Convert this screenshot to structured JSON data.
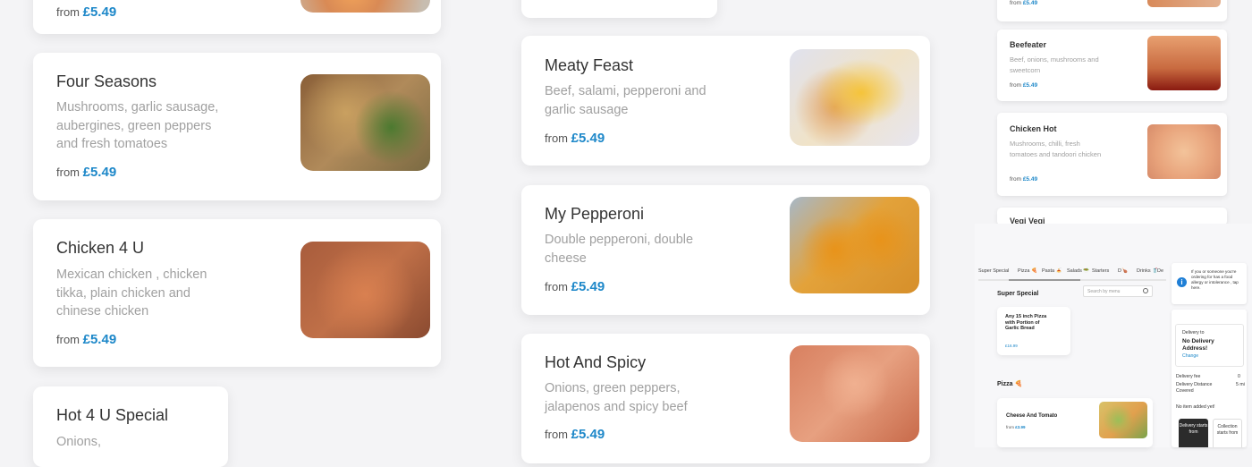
{
  "column1": {
    "top_card": {
      "price_prefix": "from",
      "price": "£5.49"
    },
    "cards": [
      {
        "name": "Four Seasons",
        "desc": "Mushrooms, garlic sausage, aubergines, green peppers and fresh tomatoes",
        "price_prefix": "from",
        "price": "£5.49"
      },
      {
        "name": "Chicken 4 U",
        "desc": "Mexican chicken , chicken tikka, plain chicken and chinese chicken",
        "price_prefix": "from",
        "price": "£5.49"
      },
      {
        "name": "Hot 4 U Special",
        "desc": "Onions,",
        "price_prefix": "",
        "price": ""
      }
    ]
  },
  "column2": {
    "cards": [
      {
        "name": "Meaty Feast",
        "desc": "Beef, salami, pepperoni and garlic sausage",
        "price_prefix": "from",
        "price": "£5.49"
      },
      {
        "name": "My Pepperoni",
        "desc": "Double pepperoni, double cheese",
        "price_prefix": "from",
        "price": "£5.49"
      },
      {
        "name": "Hot And Spicy",
        "desc": "Onions, green peppers, jalapenos and spicy beef",
        "price_prefix": "from",
        "price": "£5.49"
      }
    ]
  },
  "column3": {
    "top_card": {
      "price_prefix": "from",
      "price": "£5.49"
    },
    "cards": [
      {
        "name": "Beefeater",
        "desc": "Beef, onions, mushrooms and sweetcorn",
        "price_prefix": "from",
        "price": "£5.49"
      },
      {
        "name": "Chicken Hot",
        "desc": "Mushrooms, chilli, fresh tomatoes and tandoori chicken",
        "price_prefix": "from",
        "price": "£5.49"
      },
      {
        "name": "Vegi Vegi"
      }
    ],
    "mini": {
      "nav": [
        "Super Special",
        "Pizza 🍕",
        "Pasta 🍝",
        "Salads 🥗",
        "Starters",
        "D🍗",
        "Drinks 🥤",
        "De"
      ],
      "search_placeholder": "Search by menu",
      "section_super": "Super Special",
      "super_item": {
        "name": "Any 15 inch Pizza with Portion of Garlic Bread",
        "price": "£16.99"
      },
      "section_pizza": "Pizza 🍕",
      "pizza_item": {
        "name": "Cheese And Tomato",
        "price_prefix": "from",
        "price": "£3.99"
      },
      "info_icon": "i",
      "info_text": "If you or someone you're ordering for has a food allergy or intolerance , tap here.",
      "delivery": {
        "delivery_to": "Delivery to",
        "address": "No Delivery Address!",
        "change": "Change",
        "fee_label": "Delivery fee",
        "fee_value": "0",
        "distance_label": "Delivery Distance Covered",
        "distance_value": "5 mi",
        "empty_basket": "No item added yet!",
        "btn_delivery": "Delivery starts from",
        "btn_collection": "Collection starts from"
      }
    }
  },
  "colors": {
    "accent": "#1e88c9",
    "info": "#1f7fd6",
    "dark_button": "#2b2b2b"
  }
}
